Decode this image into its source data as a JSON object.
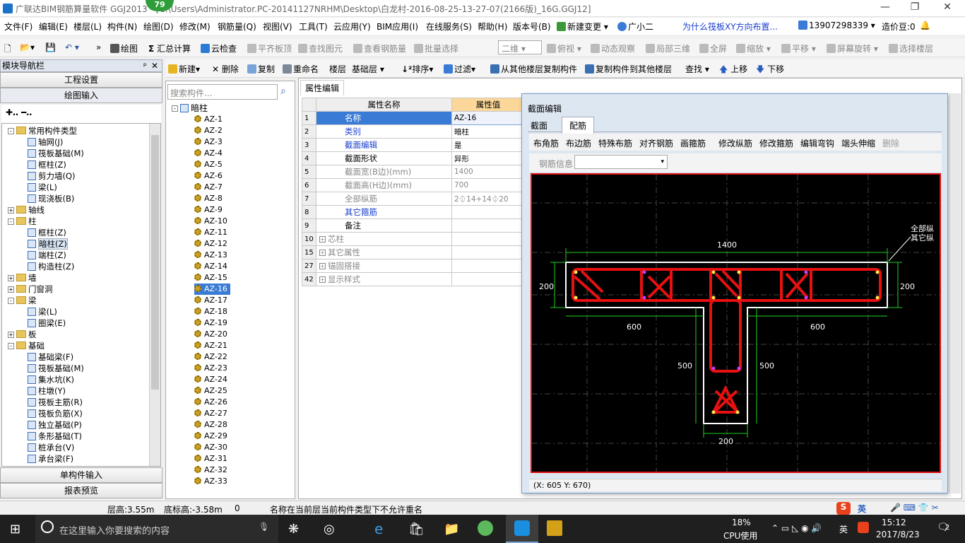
{
  "window": {
    "title": "广联达BIM钢筋算量软件 GGJ2013 - [C:\\Users\\Administrator.PC-20141127NRHM\\Desktop\\白龙村-2016-08-25-13-27-07(2166版)_16G.GGJ12]",
    "badge": "79"
  },
  "menu": [
    "文件(F)",
    "编辑(E)",
    "楼层(L)",
    "构件(N)",
    "绘图(D)",
    "修改(M)",
    "钢筋量(Q)",
    "视图(V)",
    "工具(T)",
    "云应用(Y)",
    "BIM应用(I)",
    "在线服务(S)",
    "帮助(H)",
    "版本号(B)",
    "新建变更",
    "广小二"
  ],
  "menu_right": {
    "question": "为什么筏板XY方向布置...",
    "phone": "13907298339",
    "beans": "造价豆:0"
  },
  "toolbar1": {
    "draw": "绘图",
    "sum": "汇总计算",
    "cloud": "云检查",
    "flat": "平齐板顶",
    "find": "查找图元",
    "view_rebar": "查看钢筋量",
    "batch": "批量选择",
    "view_mode": "二维",
    "top_view": "俯视",
    "dynamic": "动态观察",
    "local3d": "局部三维",
    "fullscreen": "全屏",
    "zoom": "缩放",
    "pan": "平移",
    "rotate": "屏幕旋转",
    "select_floor": "选择楼层"
  },
  "toolbar2": {
    "new": "新建",
    "delete": "删除",
    "copy": "复制",
    "rename": "重命名",
    "floor_label": "楼层",
    "floor_value": "基础层",
    "sort": "排序",
    "filter": "过滤",
    "copy_from": "从其他楼层复制构件",
    "copy_to": "复制构件到其他楼层",
    "find": "查找",
    "up": "上移",
    "down": "下移"
  },
  "nav": {
    "title": "模块导航栏",
    "btn_project": "工程设置",
    "btn_draw": "绘图输入",
    "btn_single": "单构件输入",
    "btn_report": "报表预览"
  },
  "nav_tree": [
    {
      "label": "常用构件类型",
      "level": 0,
      "type": "folder",
      "exp": "-"
    },
    {
      "label": "轴网(J)",
      "level": 1,
      "type": "comp"
    },
    {
      "label": "筏板基础(M)",
      "level": 1,
      "type": "comp"
    },
    {
      "label": "框柱(Z)",
      "level": 1,
      "type": "comp"
    },
    {
      "label": "剪力墙(Q)",
      "level": 1,
      "type": "comp"
    },
    {
      "label": "梁(L)",
      "level": 1,
      "type": "comp"
    },
    {
      "label": "现浇板(B)",
      "level": 1,
      "type": "comp"
    },
    {
      "label": "轴线",
      "level": 0,
      "type": "folder",
      "exp": "+"
    },
    {
      "label": "柱",
      "level": 0,
      "type": "folder",
      "exp": "-"
    },
    {
      "label": "框柱(Z)",
      "level": 1,
      "type": "comp"
    },
    {
      "label": "暗柱(Z)",
      "level": 1,
      "type": "comp",
      "selected": true
    },
    {
      "label": "端柱(Z)",
      "level": 1,
      "type": "comp"
    },
    {
      "label": "构造柱(Z)",
      "level": 1,
      "type": "comp"
    },
    {
      "label": "墙",
      "level": 0,
      "type": "folder",
      "exp": "+"
    },
    {
      "label": "门窗洞",
      "level": 0,
      "type": "folder",
      "exp": "+"
    },
    {
      "label": "梁",
      "level": 0,
      "type": "folder",
      "exp": "-"
    },
    {
      "label": "梁(L)",
      "level": 1,
      "type": "comp"
    },
    {
      "label": "圈梁(E)",
      "level": 1,
      "type": "comp"
    },
    {
      "label": "板",
      "level": 0,
      "type": "folder",
      "exp": "+"
    },
    {
      "label": "基础",
      "level": 0,
      "type": "folder",
      "exp": "-"
    },
    {
      "label": "基础梁(F)",
      "level": 1,
      "type": "comp"
    },
    {
      "label": "筏板基础(M)",
      "level": 1,
      "type": "comp"
    },
    {
      "label": "集水坑(K)",
      "level": 1,
      "type": "comp"
    },
    {
      "label": "柱墩(Y)",
      "level": 1,
      "type": "comp"
    },
    {
      "label": "筏板主筋(R)",
      "level": 1,
      "type": "comp"
    },
    {
      "label": "筏板负筋(X)",
      "level": 1,
      "type": "comp"
    },
    {
      "label": "独立基础(P)",
      "level": 1,
      "type": "comp"
    },
    {
      "label": "条形基础(T)",
      "level": 1,
      "type": "comp"
    },
    {
      "label": "桩承台(V)",
      "level": 1,
      "type": "comp"
    },
    {
      "label": "承台梁(F)",
      "level": 1,
      "type": "comp"
    }
  ],
  "search_placeholder": "搜索构件...",
  "comp_root": "暗柱",
  "components": [
    "AZ-1",
    "AZ-2",
    "AZ-3",
    "AZ-4",
    "AZ-5",
    "AZ-6",
    "AZ-7",
    "AZ-8",
    "AZ-9",
    "AZ-10",
    "AZ-11",
    "AZ-12",
    "AZ-13",
    "AZ-14",
    "AZ-15",
    "AZ-16",
    "AZ-17",
    "AZ-18",
    "AZ-19",
    "AZ-20",
    "AZ-21",
    "AZ-22",
    "AZ-23",
    "AZ-24",
    "AZ-25",
    "AZ-26",
    "AZ-27",
    "AZ-28",
    "AZ-29",
    "AZ-30",
    "AZ-31",
    "AZ-32",
    "AZ-33"
  ],
  "selected_component": "AZ-16",
  "props": {
    "tab": "属性编辑",
    "col_name": "属性名称",
    "col_value": "属性值",
    "rows": [
      {
        "n": "1",
        "name": "名称",
        "value": "AZ-16",
        "style": "sel"
      },
      {
        "n": "2",
        "name": "类别",
        "value": "暗柱",
        "style": "blue"
      },
      {
        "n": "3",
        "name": "截面编辑",
        "value": "是",
        "style": "blue"
      },
      {
        "n": "4",
        "name": "截面形状",
        "value": "异形",
        "style": ""
      },
      {
        "n": "5",
        "name": "截面宽(B边)(mm)",
        "value": "1400",
        "style": "gray"
      },
      {
        "n": "6",
        "name": "截面高(H边)(mm)",
        "value": "700",
        "style": "gray"
      },
      {
        "n": "7",
        "name": "全部纵筋",
        "value": "2⏀14+14⏀20",
        "style": "gray"
      },
      {
        "n": "8",
        "name": "其它箍筋",
        "value": "",
        "style": "blue"
      },
      {
        "n": "9",
        "name": "备注",
        "value": "",
        "style": ""
      },
      {
        "n": "10",
        "name": "芯柱",
        "value": "",
        "style": "gray",
        "exp": true
      },
      {
        "n": "15",
        "name": "其它属性",
        "value": "",
        "style": "gray",
        "exp": true
      },
      {
        "n": "27",
        "name": "锚固搭接",
        "value": "",
        "style": "gray",
        "exp": true
      },
      {
        "n": "42",
        "name": "显示样式",
        "value": "",
        "style": "gray",
        "exp": true
      }
    ]
  },
  "section": {
    "title": "截面编辑",
    "tab1": "截面",
    "tab2": "配筋",
    "tools": [
      "布角筋",
      "布边筋",
      "特殊布筋",
      "对齐钢筋",
      "画箍筋",
      "修改纵筋",
      "修改箍筋",
      "编辑弯钩",
      "端头伸缩",
      "删除"
    ],
    "info_label": "钢筋信息",
    "dims": {
      "top": "1400",
      "left": "200",
      "right": "200",
      "bl": "600",
      "br": "600",
      "wl": "500",
      "wr": "500",
      "bottom": "200"
    },
    "note1": "全部纵",
    "note2": "其它纵",
    "coords": "(X: 605 Y: 670)"
  },
  "status": {
    "floor_h": "层高:3.55m",
    "bottom_h": "底标高:-3.58m",
    "zero": "0",
    "msg": "名称在当前层当前构件类型下不允许重名",
    "ime": "英"
  },
  "taskbar": {
    "search": "在这里输入你要搜索的内容",
    "cpu": "18%",
    "cpu_label": "CPU使用",
    "lang": "英",
    "time": "15:12",
    "date": "2017/8/23",
    "notif": "2"
  }
}
